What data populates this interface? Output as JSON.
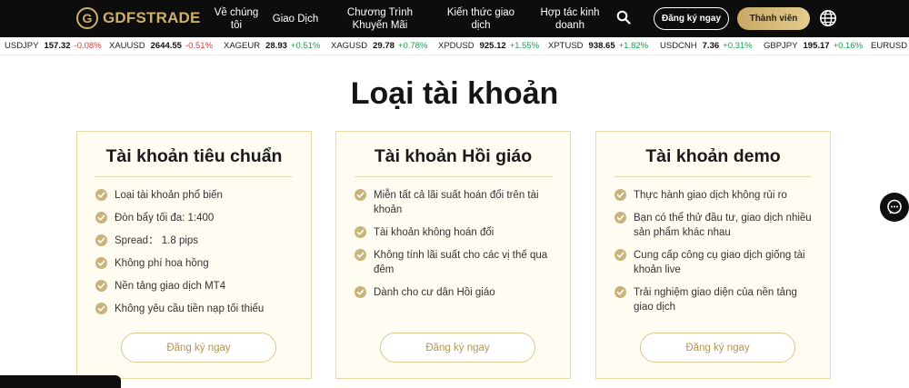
{
  "header": {
    "logo_text": "GDFSTRADE",
    "logo_mark": "G",
    "nav": [
      "Về chúng tôi",
      "Giao Dịch",
      "Chương Trình Khuyến Mãi",
      "Kiến thức giao dịch",
      "Hợp tác kinh doanh"
    ],
    "register_label": "Đăng ký ngay",
    "member_label": "Thành viên",
    "icons": {
      "search": "search-icon",
      "language": "globe-icon"
    }
  },
  "ticker": [
    {
      "symbol": "USDJPY",
      "price": "157.32",
      "change": "-0.08%",
      "dir": "down"
    },
    {
      "symbol": "XAUUSD",
      "price": "2644.55",
      "change": "-0.51%",
      "dir": "down"
    },
    {
      "symbol": "XAGEUR",
      "price": "28.93",
      "change": "+0.51%",
      "dir": "up"
    },
    {
      "symbol": "XAGUSD",
      "price": "29.78",
      "change": "+0.78%",
      "dir": "up"
    },
    {
      "symbol": "XPDUSD",
      "price": "925.12",
      "change": "+1.55%",
      "dir": "up"
    },
    {
      "symbol": "XPTUSD",
      "price": "938.65",
      "change": "+1.82%",
      "dir": "up"
    },
    {
      "symbol": "USDCNH",
      "price": "7.36",
      "change": "+0.31%",
      "dir": "up"
    },
    {
      "symbol": "GBPJPY",
      "price": "195.17",
      "change": "+0.16%",
      "dir": "up"
    },
    {
      "symbol": "EURUSD",
      "price": "",
      "change": "",
      "dir": "up"
    }
  ],
  "title": "Loại tài khoản",
  "cards": [
    {
      "title": "Tài khoản tiêu chuẩn",
      "features": [
        "Loại tài khoản phổ biến",
        "Đòn bẩy tối đa: 1:400",
        "Spread： 1.8 pips",
        "Không phí hoa hồng",
        "Nền tảng giao dịch MT4",
        "Không yêu cầu tiền nạp tối thiểu"
      ],
      "button": "Đăng ký ngay"
    },
    {
      "title": "Tài khoản Hồi giáo",
      "features": [
        "Miễn tất cả lãi suất hoán đổi trên tài khoản",
        "Tài khoản không hoán đổi",
        "Không tính lãi suất cho các vị thế qua đêm",
        "Dành cho cư dân Hồi giáo"
      ],
      "button": "Đăng ký ngay"
    },
    {
      "title": "Tài khoản demo",
      "features": [
        "Thực hành giao dịch không rủi ro",
        "Bạn có thể thử đầu tư, giao dịch nhiều sản phẩm khác nhau",
        "Cung cấp công cụ giao dịch giống tài khoản live",
        "Trải nghiệm giao diện của nền tảng giao dịch"
      ],
      "button": "Đăng ký ngay"
    }
  ],
  "colors": {
    "gold": "#cfb06b",
    "check": "#c9b37a",
    "header_bg": "#0d0d0d",
    "card_bg": "#fffcf2",
    "up": "#1aa34a",
    "down": "#e53935"
  },
  "chat": {
    "icon": "chat-bubble-icon"
  }
}
